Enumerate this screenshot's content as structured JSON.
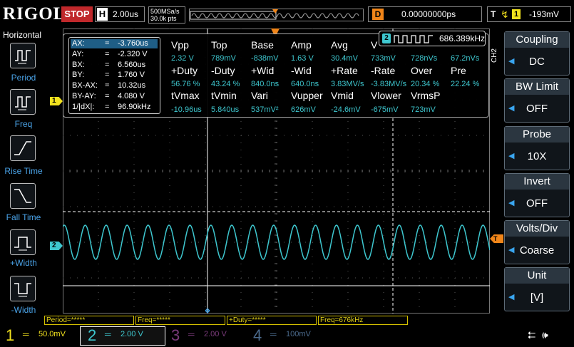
{
  "brand": "RIGOL",
  "run_state": "STOP",
  "horizontal": {
    "key": "H",
    "timebase": "2.00us",
    "sample_rate": "500MSa/s",
    "mem_depth": "30.0k pts"
  },
  "delay": {
    "key": "D",
    "value": "0.00000000ps"
  },
  "trigger": {
    "key": "T",
    "channel": "1",
    "level": "-193mV"
  },
  "left_panel": {
    "title": "Horizontal",
    "items": [
      {
        "label": "Period",
        "icon": "period-icon"
      },
      {
        "label": "Freq",
        "icon": "frequency-icon"
      },
      {
        "label": "Rise Time",
        "icon": "rise-time-icon"
      },
      {
        "label": "Fall Time",
        "icon": "fall-time-icon"
      },
      {
        "label": "+Width",
        "icon": "positive-width-icon"
      },
      {
        "label": "-Width",
        "icon": "negative-width-icon"
      }
    ]
  },
  "cursors": [
    {
      "key": "AX:",
      "eq": "=",
      "value": "-3.760us"
    },
    {
      "key": "AY:",
      "eq": "=",
      "value": "-2.320 V"
    },
    {
      "key": "BX:",
      "eq": "=",
      "value": "6.560us"
    },
    {
      "key": "BY:",
      "eq": "=",
      "value": "1.760 V"
    },
    {
      "key": "BX-AX:",
      "eq": "=",
      "value": "10.32us"
    },
    {
      "key": "BY-AY:",
      "eq": "=",
      "value": "4.080 V"
    },
    {
      "key": "1/|dX|:",
      "eq": "=",
      "value": "96.90kHz"
    }
  ],
  "measurements": {
    "row1_headers": [
      "Vpp",
      "Top",
      "Base",
      "Amp",
      "Avg",
      "V"
    ],
    "row1_values": [
      "2.32 V",
      "789mV",
      "-838mV",
      "1.63 V",
      "30.4mV",
      "733mV",
      "728nVs",
      "67.2nVs"
    ],
    "row2_headers": [
      "+Duty",
      "-Duty",
      "+Wid",
      "-Wid",
      "+Rate",
      "-Rate",
      "Over",
      "Pre"
    ],
    "row2_values": [
      "56.76 %",
      "43.24 %",
      "840.0ns",
      "640.0ns",
      "3.83MV/s",
      "-3.83MV/s",
      "20.34 %",
      "22.24 %"
    ],
    "row3_headers": [
      "tVmax",
      "tVmin",
      "Vari",
      "Vupper",
      "Vmid",
      "Vlower",
      "VrmsP"
    ],
    "row3_values": [
      "-10.96us",
      "5.840us",
      "537mV²",
      "626mV",
      "-24.6mV",
      "-675mV",
      "723mV"
    ]
  },
  "freq_badge": {
    "channel": "2",
    "value": "686.389kHz"
  },
  "markers": {
    "ch1": "1",
    "ch2": "2",
    "trigger_level": "T"
  },
  "right_panel": {
    "channel_label": "CH2",
    "groups": [
      {
        "title": "Coupling",
        "value": "DC"
      },
      {
        "title": "BW Limit",
        "value": "OFF"
      },
      {
        "title": "Probe",
        "value": "10X"
      },
      {
        "title": "Invert",
        "value": "OFF"
      },
      {
        "title": "Volts/Div",
        "value": "Coarse"
      },
      {
        "title": "Unit",
        "value": "[V]"
      }
    ]
  },
  "status_bar": [
    "Period=*****",
    "Freq=*****",
    "+Duty=*****",
    "Freq=676kHz"
  ],
  "channels": [
    {
      "num": "1",
      "scale": "50.0mV",
      "color": "#f2e21e"
    },
    {
      "num": "2",
      "scale": "2.00 V",
      "color": "#3ec7cf"
    },
    {
      "num": "3",
      "scale": "2.00 V",
      "color": "#7a3a7a"
    },
    {
      "num": "4",
      "scale": "100mV",
      "color": "#4b6a8c"
    }
  ],
  "colors": {
    "ch1": "#f2e21e",
    "ch2": "#3ec7cf",
    "accent": "#f08519",
    "stop": "#c0282b"
  }
}
